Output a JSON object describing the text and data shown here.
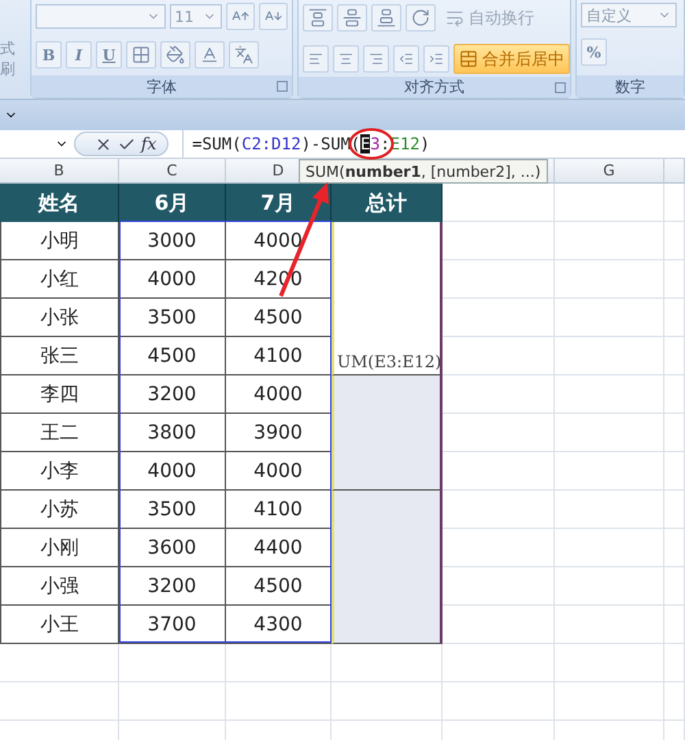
{
  "ribbon": {
    "clipboard_fragment": "式刷",
    "font_group": {
      "label": "字体",
      "font_size": "11",
      "style_buttons": [
        "B",
        "I",
        "U"
      ]
    },
    "alignment_group": {
      "label": "对齐方式",
      "wrap_button": "自动换行",
      "merge_button": {
        "label": "合并后居中",
        "selected": true
      }
    },
    "number_group": {
      "label": "数字",
      "format": "自定义",
      "percent": "%"
    }
  },
  "formula_bar": {
    "fx": "fx",
    "segments": [
      {
        "text": "=SUM("
      },
      {
        "text": "C2:D12",
        "color": "#3333cc"
      },
      {
        "text": ")-SUM("
      },
      {
        "text": "E",
        "selected": true
      },
      {
        "text": "3",
        "color": "#a020a0"
      },
      {
        "text": ":"
      },
      {
        "text": "E12",
        "color": "#2e8b2e"
      },
      {
        "text": ")"
      }
    ]
  },
  "tooltip": "SUM(**number1**, [number2], ...)",
  "column_headers": [
    "B",
    "C",
    "D",
    "G"
  ],
  "table": {
    "columns": [
      "姓名",
      "6月",
      "7月",
      "总计"
    ],
    "rows": [
      [
        "小明",
        "3000",
        "4000"
      ],
      [
        "小红",
        "4000",
        "4200"
      ],
      [
        "小张",
        "3500",
        "4500"
      ],
      [
        "张三",
        "4500",
        "4100"
      ],
      [
        "李四",
        "3200",
        "4000"
      ],
      [
        "王二",
        "3800",
        "3900"
      ],
      [
        "小李",
        "4000",
        "4000"
      ],
      [
        "小苏",
        "3500",
        "4100"
      ],
      [
        "小刚",
        "3600",
        "4400"
      ],
      [
        "小强",
        "3200",
        "4500"
      ],
      [
        "小王",
        "3700",
        "4300"
      ]
    ],
    "total_blocks": [
      {
        "text": "UM(E3:E12)",
        "shaded": false
      },
      {
        "shaded": true
      },
      {
        "shaded": true
      }
    ]
  }
}
